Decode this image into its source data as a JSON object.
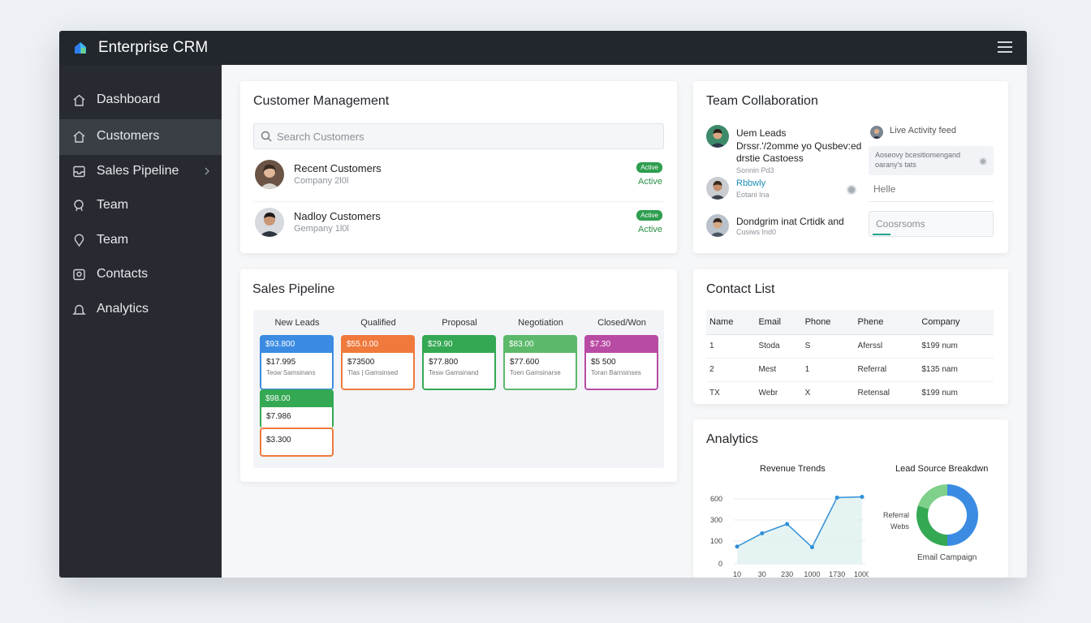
{
  "app": {
    "title": "Enterprise CRM"
  },
  "sidebar": {
    "items": [
      {
        "label": "Dashboard",
        "icon": "home-icon"
      },
      {
        "label": "Customers",
        "icon": "home-icon",
        "active": true
      },
      {
        "label": "Sales Pipeline",
        "icon": "inbox-icon",
        "has_chevron": true
      },
      {
        "label": "Team",
        "icon": "user-search-icon"
      },
      {
        "label": "Team",
        "icon": "pin-icon"
      },
      {
        "label": "Contacts",
        "icon": "contact-card-icon"
      },
      {
        "label": "Analytics",
        "icon": "bell-icon"
      }
    ]
  },
  "customer_management": {
    "title": "Customer Management",
    "search_placeholder": "Search Customers",
    "rows": [
      {
        "name": "Recent Customers",
        "sub": "Company 2l0l",
        "badge": "Active",
        "status": "Active"
      },
      {
        "name": "Nadloy Customers",
        "sub": "Gempany 1l0l",
        "badge": "Active",
        "status": "Active"
      }
    ]
  },
  "team_collaboration": {
    "title": "Team Collaboration",
    "items": [
      {
        "line1": "Uem Leads",
        "line2": "Drssr.'/2omme yo Qusbev:ed",
        "line3": "drstie Castoess",
        "small": "Sonnin Pd3"
      },
      {
        "line1": "Rbbwly",
        "small": "Eotani Ina"
      },
      {
        "line1": "Dondgrim  inat Crtidk and",
        "small": "Cusiws Ind0"
      }
    ],
    "feed": {
      "title": "Live Activity feed",
      "box_text": "Aoseovy bcesitiomengand oarany's tats",
      "hello": "Helle",
      "input_placeholder": "Coosrsoms"
    }
  },
  "sales_pipeline": {
    "title": "Sales Pipeline",
    "columns": [
      "New Leads",
      "Qualified",
      "Proposal",
      "Negotiation",
      "Closed/Won"
    ],
    "cards": [
      {
        "top": "$93.800",
        "value": "$17.995",
        "sub": "Teow Samsinans",
        "color": "#3b8be3"
      },
      {
        "top": "$55.0.00",
        "value": "$73500",
        "sub": "Tlas | Gamsinsed",
        "color": "#ef7a3c"
      },
      {
        "top": "$29.90",
        "value": "$77.800",
        "sub": "Tesw Gamsinand",
        "color": "#34a853"
      },
      {
        "top": "$83.00",
        "value": "$77.600",
        "sub": "Toen Gamsinarse",
        "color": "#5cb96a"
      },
      {
        "top": "$7.30",
        "value": "$5 500",
        "sub": "Toran Barnsinses",
        "color": "#b84ba4"
      }
    ],
    "extra_cards": [
      {
        "top": "$98.00",
        "value": "$7.986",
        "color": "#34a853"
      },
      {
        "value": "$3.300",
        "color": "#ef7a3c"
      }
    ]
  },
  "contact_list": {
    "title": "Contact List",
    "columns": [
      "Name",
      "Email",
      "Phone",
      "Phene",
      "Company"
    ],
    "rows": [
      [
        "1",
        "Stoda",
        "S",
        "Aferssl",
        "$199 num"
      ],
      [
        "2",
        "Mest",
        "1",
        "Referral",
        "$135 nam"
      ],
      [
        "TX",
        "Webr",
        "X",
        "Retensal",
        "$199 num"
      ]
    ]
  },
  "analytics": {
    "title": "Analytics",
    "revenue_chart": {
      "title": "Revenue Trends",
      "y_ticks": [
        "600",
        "300",
        "100",
        "0"
      ],
      "x_ticks": [
        "10",
        "30",
        "230",
        "1000",
        "1730",
        "1000"
      ]
    },
    "lead_chart": {
      "title": "Lead Source Breakdwn",
      "labels": [
        "Referral",
        "Webs"
      ],
      "bottom_label": "Email Campaign"
    }
  },
  "chart_data": [
    {
      "type": "line",
      "title": "Revenue Trends",
      "y_tick_labels": [
        "0",
        "100",
        "300",
        "600"
      ],
      "x_tick_labels": [
        "10",
        "30",
        "230",
        "1000",
        "1730",
        "1000"
      ],
      "points": [
        {
          "x": "10",
          "y": 130
        },
        {
          "x": "30",
          "y": 230
        },
        {
          "x": "230",
          "y": 300
        },
        {
          "x": "1000",
          "y": 125
        },
        {
          "x": "1730",
          "y": 500
        },
        {
          "x": "1000",
          "y": 505
        }
      ],
      "ylim": [
        0,
        600
      ],
      "area_fill": true
    },
    {
      "type": "pie",
      "title": "Lead Source Breakdwn",
      "slices": [
        {
          "label": "Referral",
          "value": 50,
          "color": "#3b8be3"
        },
        {
          "label": "Webs",
          "value": 30,
          "color": "#34a853"
        },
        {
          "label": "Email Campaign",
          "value": 20,
          "color": "#7fd08a"
        }
      ],
      "donut": true
    }
  ]
}
